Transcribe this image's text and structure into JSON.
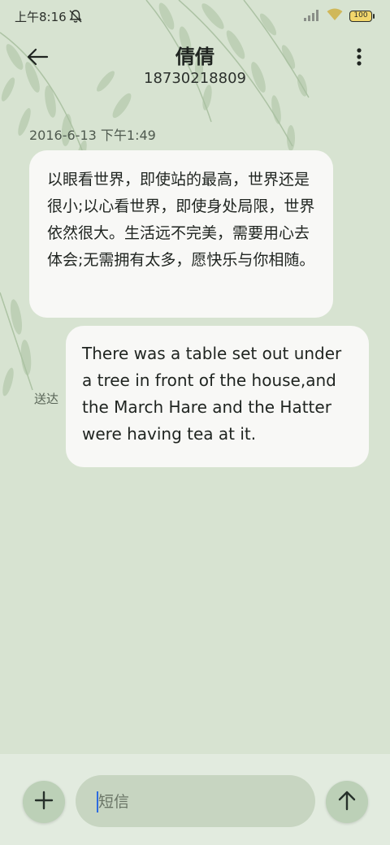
{
  "status_bar": {
    "time": "上午8:16",
    "battery": "100",
    "icons": [
      "mute-icon",
      "signal-icon",
      "wifi-icon",
      "battery-icon"
    ]
  },
  "header": {
    "contact_name": "倩倩",
    "phone_number": "18730218809",
    "icons": [
      "back-arrow-icon",
      "more-vert-icon"
    ]
  },
  "thread": {
    "timestamp": "2016-6-13 下午1:49",
    "incoming_message": "以眼看世界，即使站的最高，世界还是很小;以心看世界，即使身处局限，世界依然很大。生活远不完美，需要用心去体会;无需拥有太多，愿快乐与你相随。",
    "outgoing_message": "There was a table set out under a tree in front of the house,and the March Hare and the Hatter were having tea at it.",
    "delivered_label": "送达"
  },
  "composer": {
    "placeholder": "短信",
    "value": "",
    "icons": [
      "plus-icon",
      "send-arrow-up-icon"
    ]
  },
  "colors": {
    "background": "#d7e3d1",
    "bubble": "#f8f8f6",
    "composer_bar": "#e2ebdf",
    "button": "#bcd0b7",
    "caret": "#2d6be0"
  }
}
